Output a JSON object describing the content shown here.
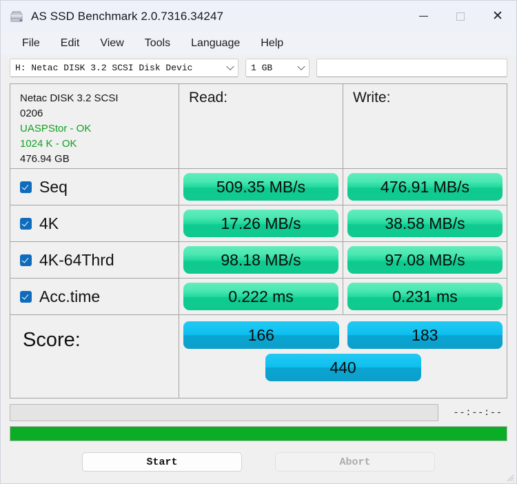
{
  "window": {
    "title": "AS SSD Benchmark 2.0.7316.34247",
    "icon": "ssd-drive-icon",
    "minimize_label": "—",
    "maximize_label": "□",
    "close_label": "✕"
  },
  "menu": {
    "items": [
      "File",
      "Edit",
      "View",
      "Tools",
      "Language",
      "Help"
    ]
  },
  "toolbar": {
    "drive_select": "H: Netac DISK 3.2 SCSI Disk Devic",
    "size_select": "1 GB",
    "info_field": ""
  },
  "drive_info": {
    "line1": "Netac DISK 3.2 SCSI",
    "line2": "0206",
    "line3": "UASPStor - OK",
    "line4": "1024 K - OK",
    "line5": "476.94 GB"
  },
  "columns": {
    "read": "Read:",
    "write": "Write:"
  },
  "rows": [
    {
      "label": "Seq",
      "checked": true,
      "read": "509.35 MB/s",
      "write": "476.91 MB/s"
    },
    {
      "label": "4K",
      "checked": true,
      "read": "17.26 MB/s",
      "write": "38.58 MB/s"
    },
    {
      "label": "4K-64Thrd",
      "checked": true,
      "read": "98.18 MB/s",
      "write": "97.08 MB/s"
    },
    {
      "label": "Acc.time",
      "checked": true,
      "read": "0.222 ms",
      "write": "0.231 ms"
    }
  ],
  "score": {
    "label": "Score:",
    "read": "166",
    "write": "183",
    "total": "440"
  },
  "status": {
    "message": "",
    "timer": "--:--:--",
    "progress_percent": 100
  },
  "buttons": {
    "start": "Start",
    "abort": "Abort"
  },
  "colors": {
    "bar_green_top": "#62edbc",
    "bar_green_bottom": "#11c98f",
    "bar_blue_top": "#22c9f2",
    "bar_blue_bottom": "#0c9fc9",
    "progress_green": "#0bad26",
    "checkbox_blue": "#0f6cbd",
    "info_green": "#12a021",
    "titlebar": "#eef1f8"
  }
}
